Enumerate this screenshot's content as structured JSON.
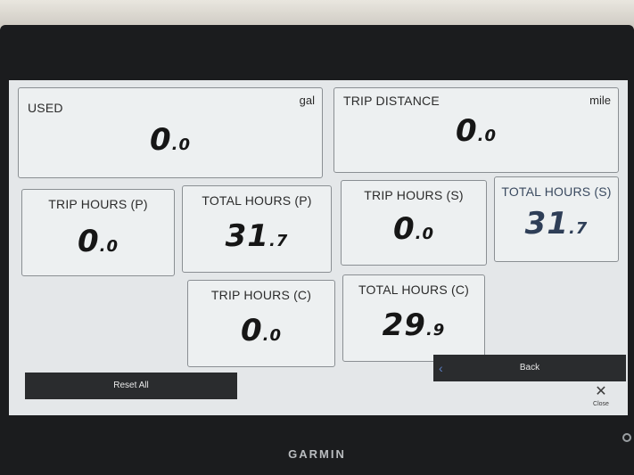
{
  "brand": "GARMIN",
  "tiles": {
    "used": {
      "label": "USED",
      "unit": "gal",
      "value_int": "0",
      "value_dec": ".0"
    },
    "trip_distance": {
      "label": "TRIP DISTANCE",
      "unit": "mile",
      "value_int": "0",
      "value_dec": ".0"
    },
    "trip_hours_p": {
      "label": "TRIP HOURS (P)",
      "value_int": "0",
      "value_dec": ".0"
    },
    "total_hours_p": {
      "label": "TOTAL HOURS (P)",
      "value_int": "31",
      "value_dec": ".7"
    },
    "trip_hours_s": {
      "label": "TRIP HOURS (S)",
      "value_int": "0",
      "value_dec": ".0"
    },
    "total_hours_s": {
      "label": "TOTAL HOURS (S)",
      "value_int": "31",
      "value_dec": ".7"
    },
    "trip_hours_c": {
      "label": "TRIP HOURS (C)",
      "value_int": "0",
      "value_dec": ".0"
    },
    "total_hours_c": {
      "label": "TOTAL HOURS (C)",
      "value_int": "29",
      "value_dec": ".9"
    }
  },
  "buttons": {
    "reset_all": "Reset All",
    "back": "Back",
    "close": "Close"
  },
  "colors": {
    "back_chevron": "#5b7fc4",
    "value_dark": "#161616",
    "value_blue": "#2e3e57"
  },
  "icons": {
    "back": "chevron-left-icon",
    "close": "close-icon",
    "power": "power-icon"
  }
}
